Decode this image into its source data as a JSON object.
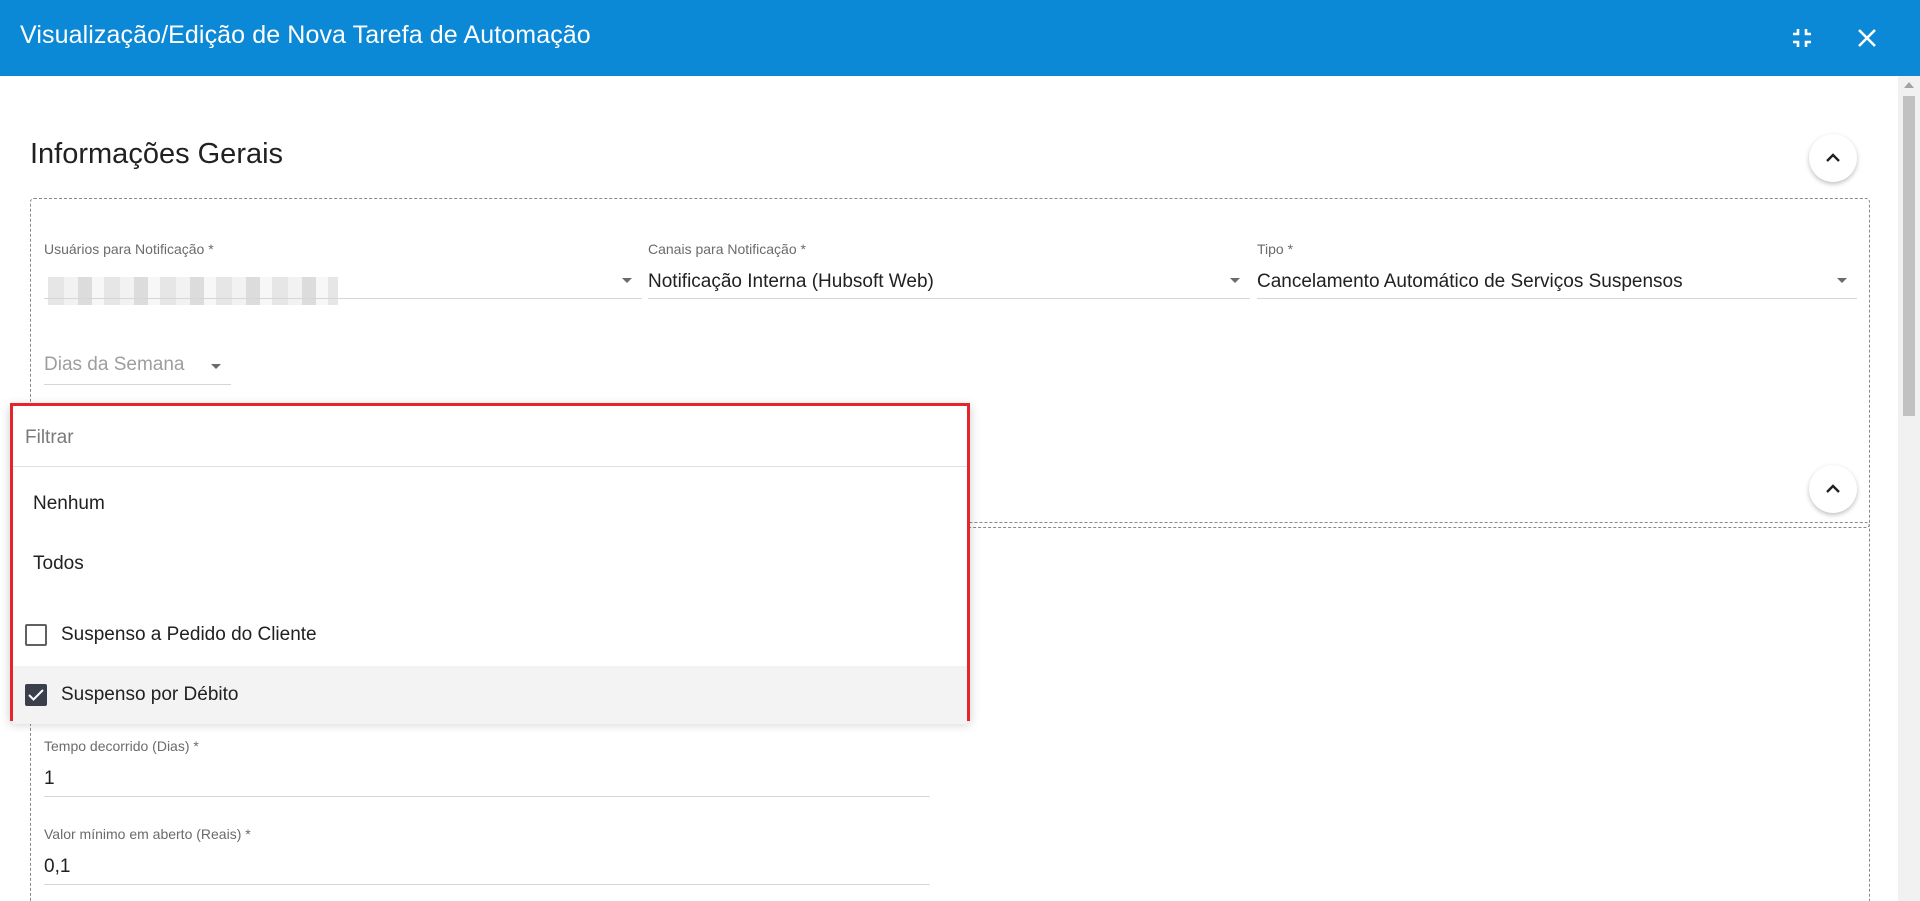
{
  "window": {
    "title": "Visualização/Edição de Nova Tarefa de Automação",
    "collapse_icon": "fullscreen-exit-icon",
    "close_icon": "close-icon"
  },
  "general_info": {
    "title": "Informações Gerais",
    "fields": {
      "users": {
        "label": "Usuários para Notificação",
        "required": "*",
        "value": ""
      },
      "channels": {
        "label": "Canais para Notificação",
        "required": "*",
        "value": "Notificação Interna (Hubsoft Web)"
      },
      "type": {
        "label": "Tipo",
        "required": "*",
        "value": "Cancelamento Automático de Serviços Suspensos"
      },
      "weekdays": {
        "placeholder": "Dias da Semana"
      }
    }
  },
  "dropdown": {
    "filter_placeholder": "Filtrar",
    "none_label": "Nenhum",
    "all_label": "Todos",
    "options": [
      {
        "label": "Suspenso a Pedido do Cliente",
        "checked": false
      },
      {
        "label": "Suspenso por Débito",
        "checked": true
      }
    ]
  },
  "second_section": {
    "elapsed": {
      "label": "Tempo decorrido (Dias)",
      "required": "*",
      "value": "1"
    },
    "min_value": {
      "label": "Valor mínimo em aberto (Reais)",
      "required": "*",
      "value": "0,1"
    }
  },
  "colors": {
    "header": "#0b88d6",
    "highlight_border": "#e4262a",
    "checkbox_checked": "#3a3f4b"
  }
}
